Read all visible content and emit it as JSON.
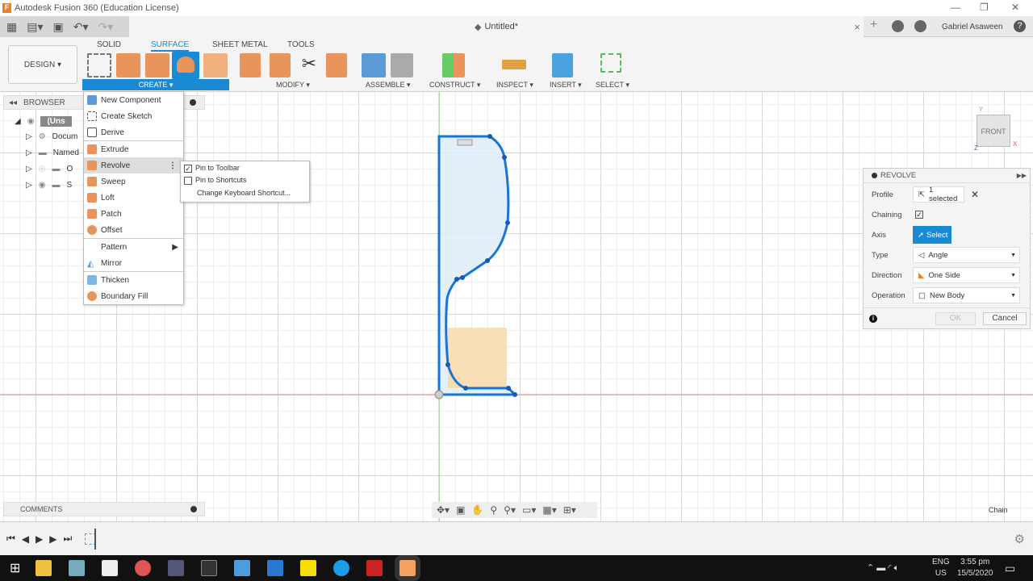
{
  "window": {
    "title": "Autodesk Fusion 360 (Education License)",
    "doc_title": "Untitled*",
    "user": "Gabriel Asaween"
  },
  "ribbon": {
    "tabs": [
      "SOLID",
      "SURFACE",
      "SHEET METAL",
      "TOOLS"
    ],
    "active_tab": "SURFACE",
    "workspace": "DESIGN ▾",
    "groups": [
      "CREATE ▾",
      "MODIFY ▾",
      "ASSEMBLE ▾",
      "CONSTRUCT ▾",
      "INSPECT ▾",
      "INSERT ▾",
      "SELECT ▾"
    ]
  },
  "browser": {
    "title": "BROWSER",
    "items": [
      "(Uns",
      "Docum",
      "Named",
      "O",
      "S"
    ]
  },
  "create_menu": {
    "items": [
      "New Component",
      "Create Sketch",
      "Derive",
      "Extrude",
      "Revolve",
      "Sweep",
      "Loft",
      "Patch",
      "Offset",
      "Pattern",
      "Mirror",
      "Thicken",
      "Boundary Fill"
    ],
    "highlighted": "Revolve"
  },
  "submenu": {
    "items": [
      {
        "label": "Pin to Toolbar",
        "checked": true
      },
      {
        "label": "Pin to Shortcuts",
        "checked": false
      },
      {
        "label": "Change Keyboard Shortcut...",
        "checked": null
      }
    ]
  },
  "viewcube": {
    "face": "FRONT",
    "axes": [
      "Y",
      "Z",
      "X"
    ]
  },
  "revolve_panel": {
    "title": "REVOLVE",
    "profile_label": "Profile",
    "profile_value": "1 selected",
    "chaining_label": "Chaining",
    "chaining": true,
    "axis_label": "Axis",
    "axis_value": "Select",
    "type_label": "Type",
    "type_value": "Angle",
    "direction_label": "Direction",
    "direction_value": "One Side",
    "operation_label": "Operation",
    "operation_value": "New Body",
    "ok": "OK",
    "cancel": "Cancel"
  },
  "comments": {
    "title": "COMMENTS"
  },
  "status": {
    "mode": "Chain"
  },
  "taskbar": {
    "lang": "ENG",
    "region": "US",
    "time": "3:55 pm",
    "date": "15/5/2020"
  },
  "colors": {
    "accent": "#1a8ad4",
    "sketch": "#1a74d4",
    "profile_fill": "#dcecf9",
    "body_fill": "#f7d9a8"
  }
}
